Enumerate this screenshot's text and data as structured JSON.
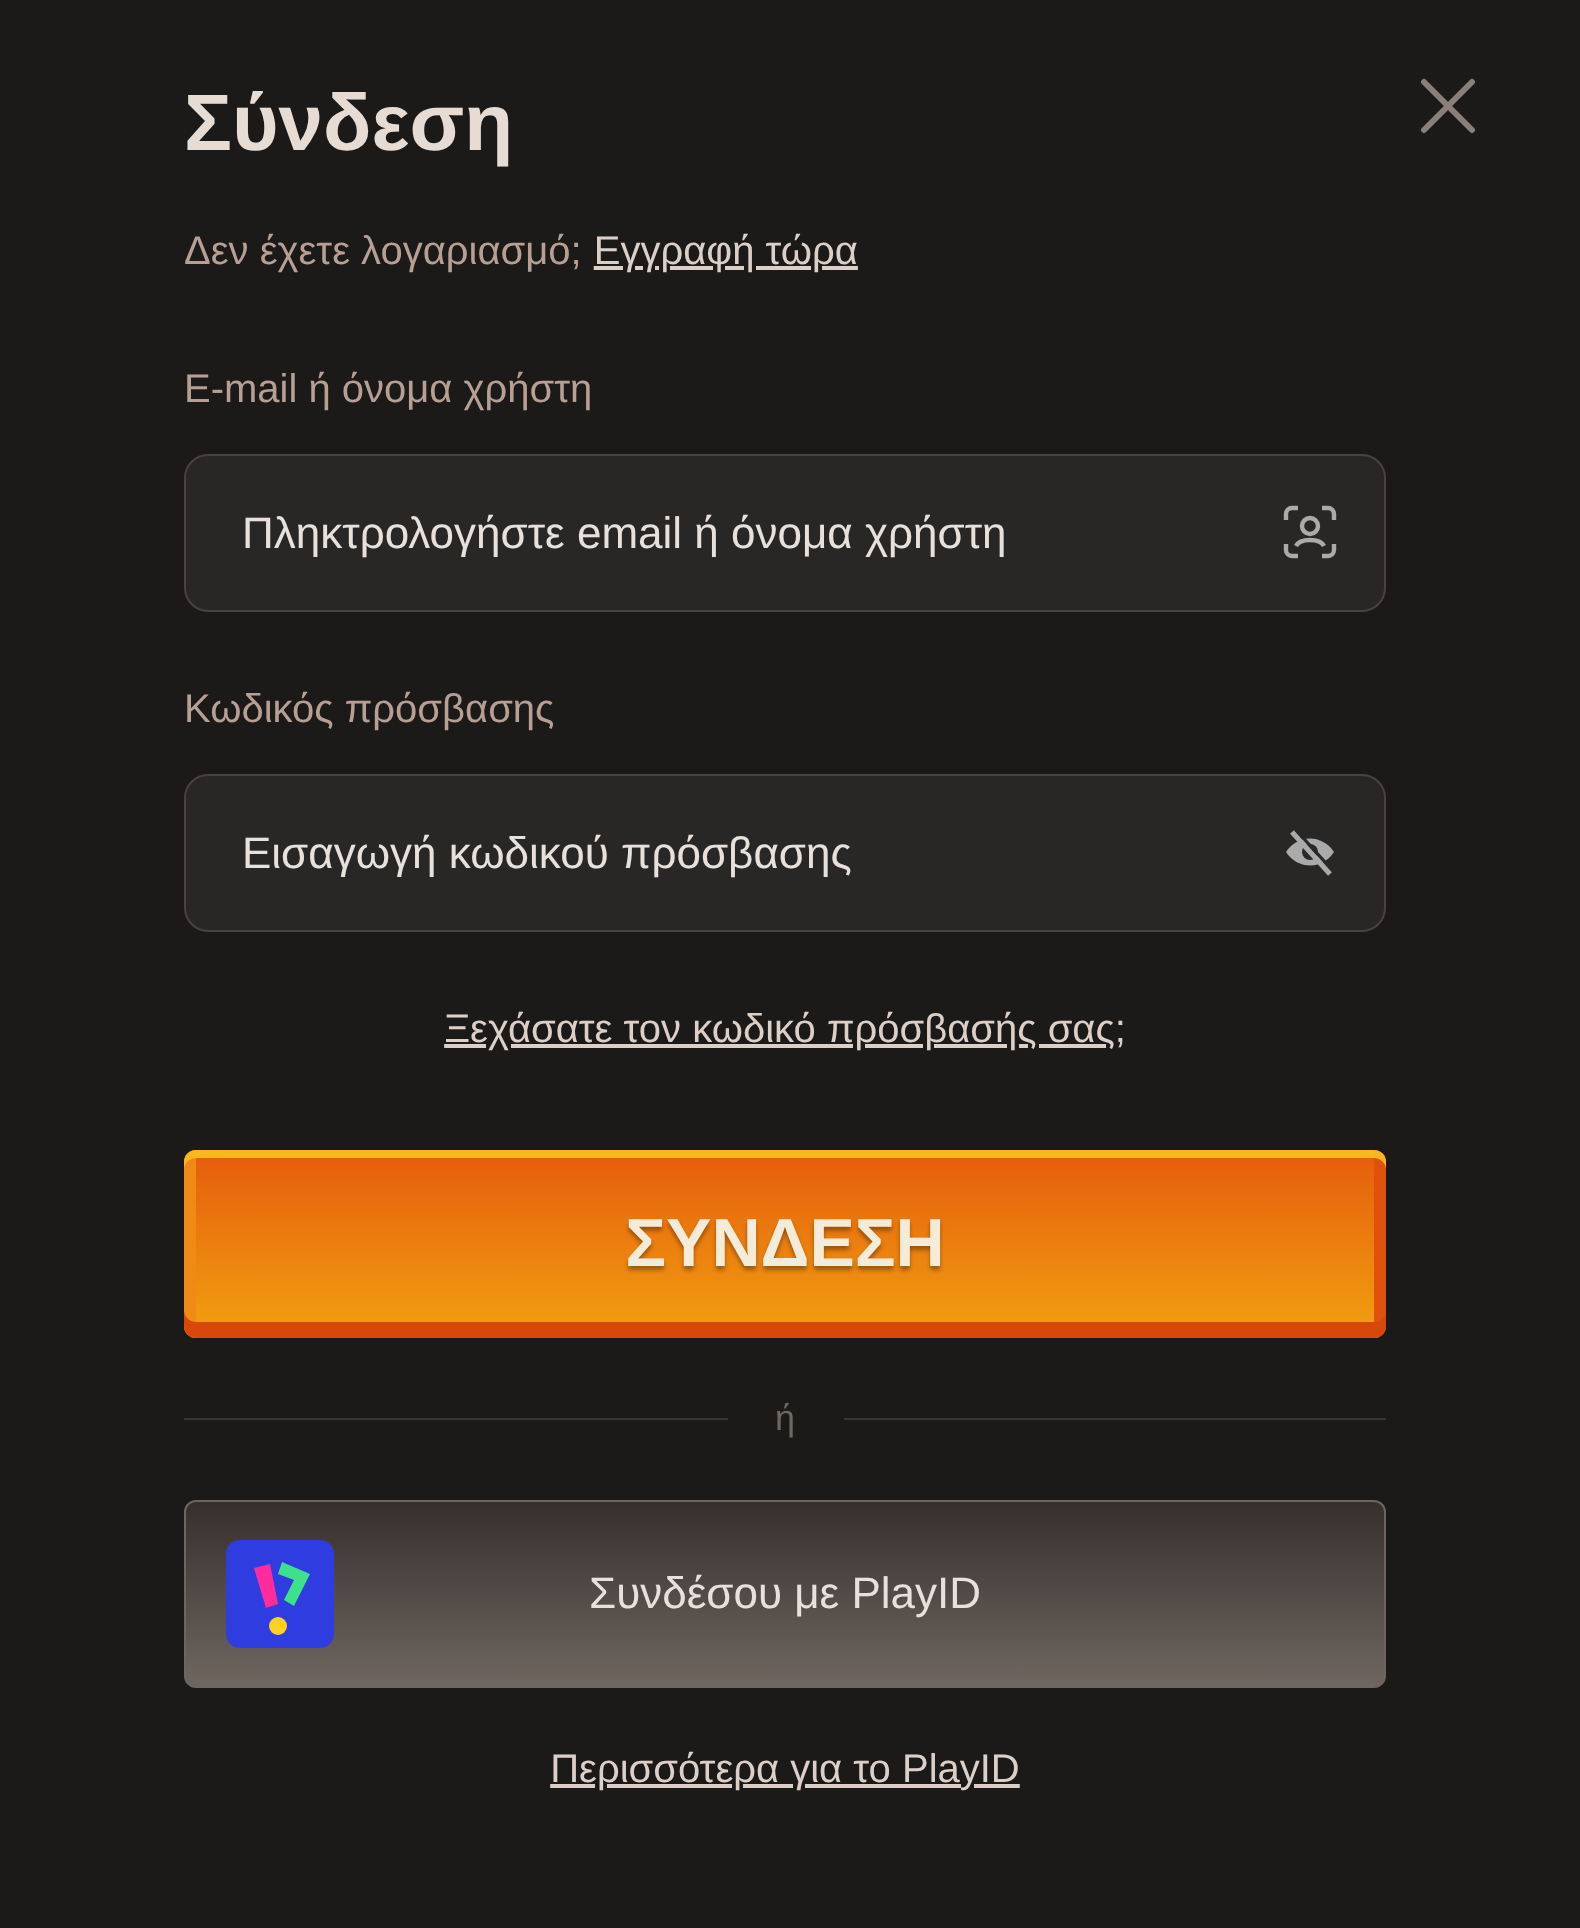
{
  "dialog": {
    "title": "Σύνδεση",
    "register_prompt": "Δεν έχετε λογαριασμό;",
    "register_link": "Εγγραφή τώρα",
    "fields": [
      {
        "kind": "username",
        "label": "E-mail ή όνομα χρήστη",
        "placeholder": "Πληκτρολογήστε email ή όνομα χρήστη"
      },
      {
        "kind": "password",
        "label": "Κωδικός πρόσβασης",
        "placeholder": "Εισαγωγή κωδικού πρόσβασης"
      }
    ],
    "forgot_link": "Ξεχάσατε τον κωδικό πρόσβασής σας;",
    "login_button": "ΣΥΝΔΕΣΗ",
    "divider": "ή",
    "playid_button": "Συνδέσου με PlayID",
    "playid_link": "Περισσότερα για το PlayID"
  }
}
